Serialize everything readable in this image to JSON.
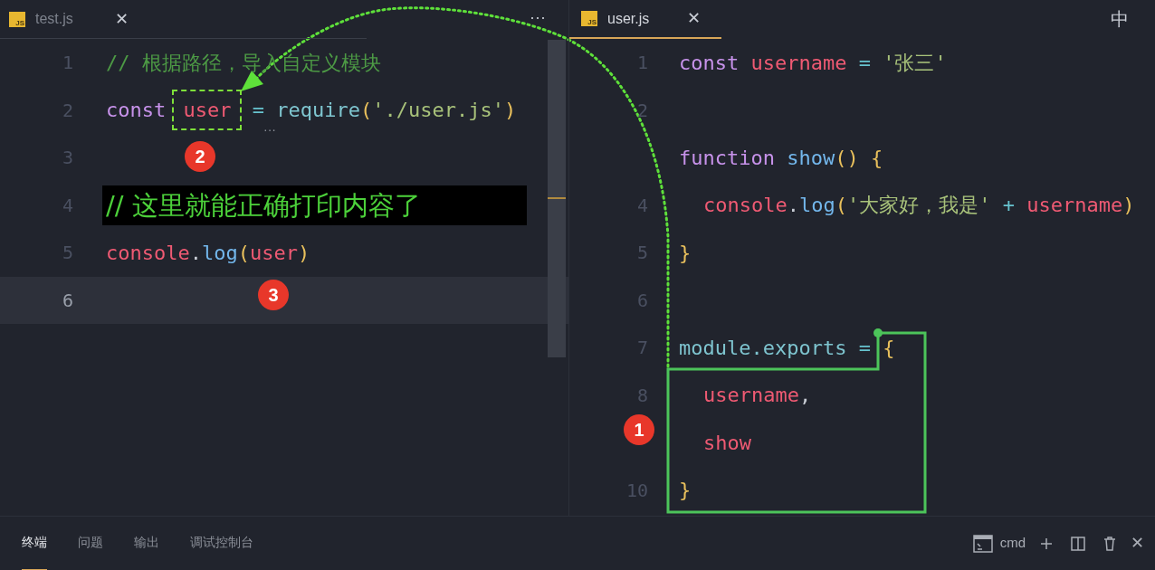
{
  "panes": [
    {
      "tab": {
        "icon": "JS",
        "label": "test.js",
        "selected": false,
        "close": "✕"
      },
      "more": "···",
      "hint": "···",
      "lines": [
        {
          "number": "1",
          "current": false,
          "tokens": [
            {
              "text": "// 根据路径，导入自定义模块",
              "kind": "comment"
            }
          ]
        },
        {
          "number": "2",
          "current": false,
          "tokens": [
            {
              "text": "const ",
              "kind": "keyword"
            },
            {
              "text": "user",
              "kind": "variable",
              "highlight": true
            },
            {
              "text": " = ",
              "kind": "operator"
            },
            {
              "text": "require",
              "kind": "call"
            },
            {
              "text": "(",
              "kind": "bracket"
            },
            {
              "text": "'./user.js'",
              "kind": "string"
            },
            {
              "text": ")",
              "kind": "bracket"
            }
          ]
        },
        {
          "number": "3",
          "current": false
        },
        {
          "number": "4",
          "current": false,
          "tokens": [
            {
              "text": "// 这里就能正确打印内容了",
              "kind": "note"
            }
          ]
        },
        {
          "number": "5",
          "current": false,
          "tokens": [
            {
              "text": "console",
              "kind": "variable"
            },
            {
              "text": ".",
              "kind": "plain"
            },
            {
              "text": "log",
              "kind": "method"
            },
            {
              "text": "(",
              "kind": "bracket"
            },
            {
              "text": "user",
              "kind": "variable"
            },
            {
              "text": ")",
              "kind": "bracket"
            }
          ]
        },
        {
          "number": "6",
          "current": true
        }
      ]
    },
    {
      "tab": {
        "icon": "JS",
        "label": "user.js",
        "selected": true,
        "close": "✕"
      },
      "more": "中",
      "lines": [
        {
          "number": "1",
          "current": false,
          "tokens": [
            {
              "text": "const ",
              "kind": "keyword"
            },
            {
              "text": "username",
              "kind": "variable"
            },
            {
              "text": " = ",
              "kind": "operator"
            },
            {
              "text": "'张三'",
              "kind": "string"
            }
          ]
        },
        {
          "number": "2",
          "current": false
        },
        {
          "current": false,
          "tokens": [
            {
              "text": "function ",
              "kind": "keyword"
            },
            {
              "text": "show",
              "kind": "method"
            },
            {
              "text": "()",
              "kind": "bracket"
            },
            {
              "text": " {",
              "kind": "bracket"
            }
          ]
        },
        {
          "number": "4",
          "current": false,
          "indent": true,
          "tokens": [
            {
              "text": "console",
              "kind": "variable"
            },
            {
              "text": ".",
              "kind": "plain"
            },
            {
              "text": "log",
              "kind": "method"
            },
            {
              "text": "(",
              "kind": "bracket"
            },
            {
              "text": "'大家好，我是'",
              "kind": "string"
            },
            {
              "text": " + ",
              "kind": "operator"
            },
            {
              "text": "username",
              "kind": "variable"
            },
            {
              "text": ")",
              "kind": "bracket"
            }
          ]
        },
        {
          "number": "5",
          "current": false,
          "tokens": [
            {
              "text": "}",
              "kind": "bracket"
            }
          ]
        },
        {
          "number": "6",
          "current": false
        },
        {
          "number": "7",
          "current": false,
          "tokens": [
            {
              "text": "module.exports",
              "kind": "property"
            },
            {
              "text": " = ",
              "kind": "operator"
            },
            {
              "text": "{",
              "kind": "bracket"
            }
          ]
        },
        {
          "number": "8",
          "current": false,
          "indent": true,
          "tokens": [
            {
              "text": "username",
              "kind": "variable"
            },
            {
              "text": ",",
              "kind": "plain"
            }
          ]
        },
        {
          "current": false,
          "indent": true,
          "tokens": [
            {
              "text": "show",
              "kind": "variable"
            }
          ]
        },
        {
          "number": "10",
          "current": false,
          "tokens": [
            {
              "text": "}",
              "kind": "bracket"
            }
          ]
        }
      ]
    }
  ],
  "badges": [
    {
      "label": "1"
    },
    {
      "label": "2"
    },
    {
      "label": "3"
    }
  ],
  "panel": {
    "tabs": [
      {
        "label": "终端",
        "selected": true
      },
      {
        "label": "问题",
        "selected": false
      },
      {
        "label": "输出",
        "selected": false
      },
      {
        "label": "调试控制台",
        "selected": false
      }
    ],
    "terminal": "cmd",
    "close": "✕"
  }
}
